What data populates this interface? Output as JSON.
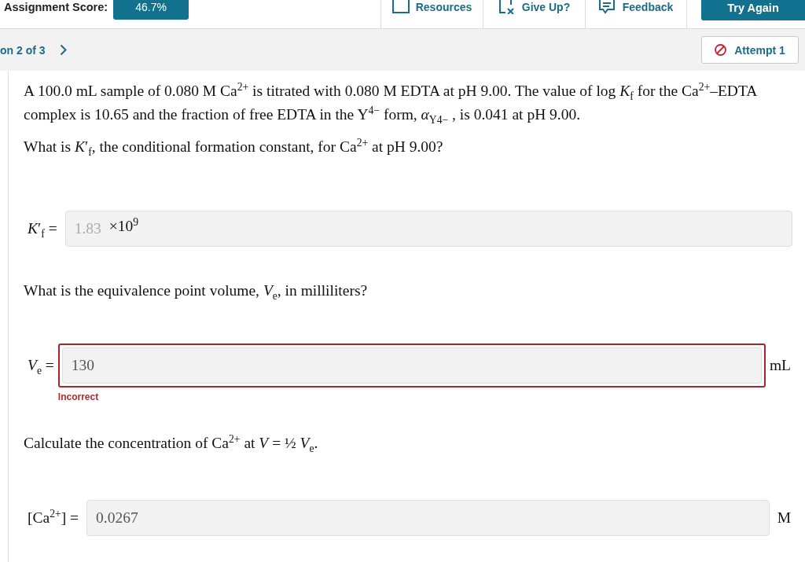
{
  "header": {
    "score_label": "Assignment Score:",
    "score": "46.7%",
    "tools": [
      {
        "kind": "resources",
        "label": "Resources"
      },
      {
        "kind": "give_up",
        "label": "Give Up?"
      },
      {
        "kind": "feedback",
        "label": "Feedback"
      }
    ],
    "try_again": "Try Again"
  },
  "question_nav": {
    "position": "on 2 of 3",
    "attempt": "Attempt 1"
  },
  "question": {
    "intro": "A 100.0 mL sample of 0.080 M Ca$^{2+}$ is titrated with 0.080 M EDTA at pH 9.00. The value of log *K*$_{f}$ for the Ca$^{2+}$–EDTA complex is 10.65 and the fraction of free EDTA in the Y$^{4−}$ form, *α*$_{Y4−}$ , is 0.041 at pH 9.00.",
    "parts": [
      {
        "prompt": "What is *K*′$_{f}$, the conditional formation constant, for Ca$^{2+}$ at pH 9.00?",
        "label": "*K*′$_{f}$ =",
        "value": "1.83",
        "suffix": "×10$^{9}$",
        "disabled": true,
        "incorrect": false
      },
      {
        "prompt": "What is the equivalence point volume, *V*$_{e}$, in milliliters?",
        "label": "*V*$_{e}$ =",
        "value": "130",
        "unit": "mL",
        "disabled": false,
        "incorrect": true,
        "feedback": "Incorrect"
      },
      {
        "prompt": "Calculate the concentration of Ca$^{2+}$ at *V* = ½ *V*$_{e}$.",
        "label": "[Ca$^{2+}$] =",
        "value": "0.0267",
        "unit": "M",
        "disabled": false,
        "incorrect": false
      }
    ]
  }
}
